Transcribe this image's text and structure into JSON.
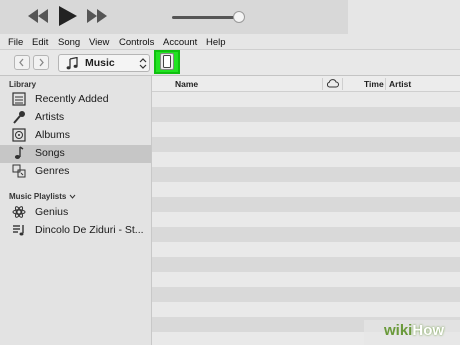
{
  "menubar": {
    "items": [
      "File",
      "Edit",
      "Song",
      "View",
      "Controls",
      "Account",
      "Help"
    ]
  },
  "toolbar": {
    "media_type": "Music"
  },
  "sidebar": {
    "library_label": "Library",
    "library_items": [
      {
        "label": "Recently Added",
        "icon": "recently-added-icon"
      },
      {
        "label": "Artists",
        "icon": "microphone-icon"
      },
      {
        "label": "Albums",
        "icon": "album-icon"
      },
      {
        "label": "Songs",
        "icon": "music-note-icon",
        "selected": true
      },
      {
        "label": "Genres",
        "icon": "genres-icon"
      }
    ],
    "playlists_label": "Music Playlists",
    "playlist_items": [
      {
        "label": "Genius",
        "icon": "genius-icon"
      },
      {
        "label": "Dincolo De Ziduri - St...",
        "icon": "playlist-icon"
      }
    ]
  },
  "table": {
    "columns": [
      "Name",
      "Time",
      "Artist"
    ],
    "cloud_icon": "cloud-icon"
  },
  "watermark": {
    "wiki": "wiki",
    "how": "How"
  },
  "colors": {
    "highlight": "#22e322",
    "watermark_green": "#6a9a3a"
  }
}
